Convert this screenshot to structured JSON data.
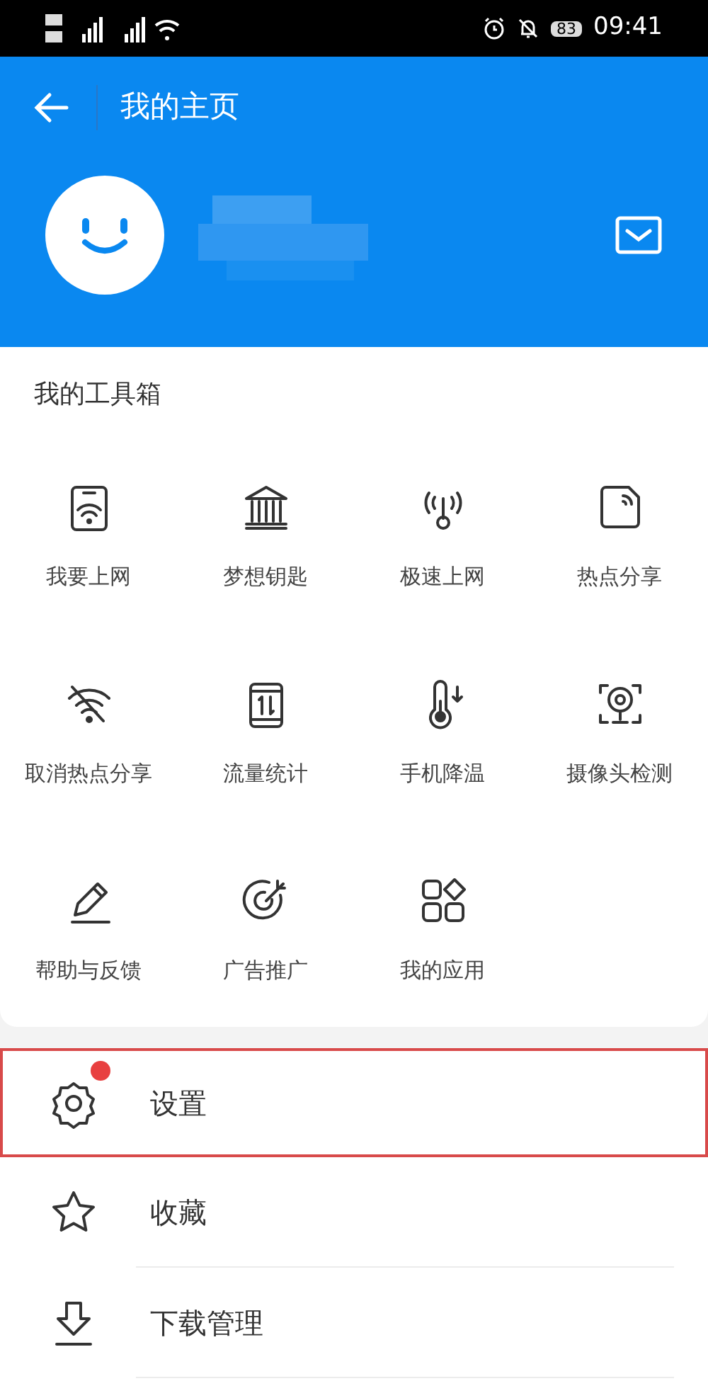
{
  "status_bar": {
    "battery": "83",
    "time": "09:41"
  },
  "header": {
    "title": "我的主页"
  },
  "toolbox": {
    "title": "我的工具箱",
    "items": [
      {
        "label": "我要上网"
      },
      {
        "label": "梦想钥匙"
      },
      {
        "label": "极速上网"
      },
      {
        "label": "热点分享"
      },
      {
        "label": "取消热点分享"
      },
      {
        "label": "流量统计"
      },
      {
        "label": "手机降温"
      },
      {
        "label": "摄像头检测"
      },
      {
        "label": "帮助与反馈"
      },
      {
        "label": "广告推广"
      },
      {
        "label": "我的应用"
      }
    ]
  },
  "menu": [
    {
      "label": "设置",
      "badge": true,
      "highlighted": true
    },
    {
      "label": "收藏",
      "badge": false,
      "highlighted": false
    },
    {
      "label": "下载管理",
      "badge": false,
      "highlighted": false
    }
  ]
}
